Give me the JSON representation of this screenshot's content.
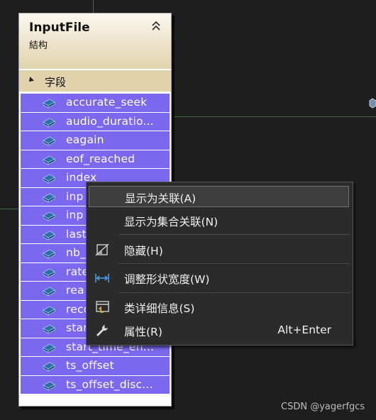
{
  "colors": {
    "canvas": "#1e1e1e",
    "field_bg": "#7b68ee",
    "header_bg": "#e2d3ad",
    "menu_bg": "#2b2b2b"
  },
  "shape": {
    "title": "InputFile",
    "subtitle": "結构",
    "section": "字段",
    "fields": [
      "accurate_seek",
      "audio_duratio...",
      "eagain",
      "eof_reached",
      "index",
      "inp",
      "inp",
      "last",
      "nb_",
      "rate",
      "rea",
      "reco",
      "star",
      "start_time_eff...",
      "ts_offset",
      "ts_offset_disc..."
    ]
  },
  "context_menu": {
    "items": [
      {
        "label": "显示为关联(A)",
        "icon": "",
        "shortcut": ""
      },
      {
        "label": "显示为集合关联(N)",
        "icon": "",
        "shortcut": ""
      },
      {
        "label": "隐藏(H)",
        "icon": "hide-icon",
        "shortcut": ""
      },
      {
        "label": "调整形状宽度(W)",
        "icon": "adjust-width-icon",
        "shortcut": ""
      },
      {
        "label": "类详细信息(S)",
        "icon": "class-details-icon",
        "shortcut": ""
      },
      {
        "label": "属性(R)",
        "icon": "wrench-icon",
        "shortcut": "Alt+Enter"
      }
    ]
  },
  "watermark": "CSDN @yagerfgcs"
}
